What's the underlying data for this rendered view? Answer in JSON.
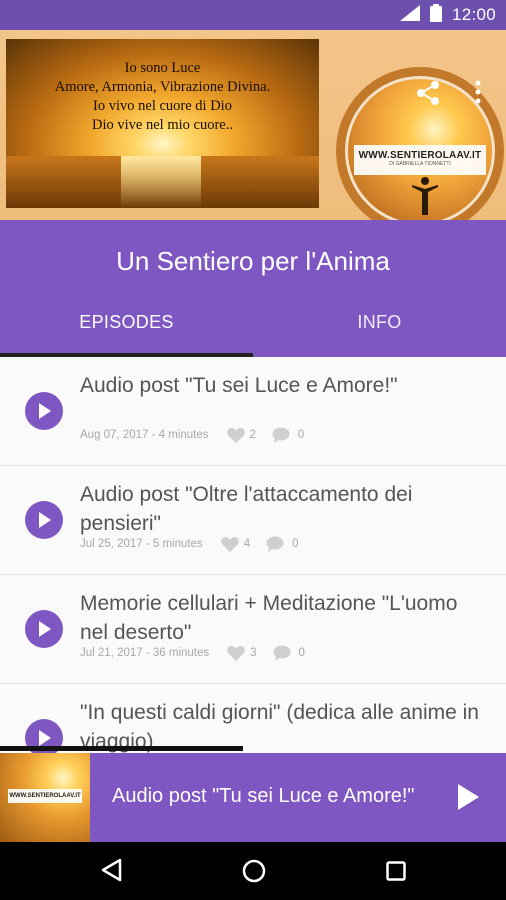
{
  "status_bar": {
    "time": "12:00"
  },
  "hero": {
    "quote_lines": [
      "Io sono Luce",
      "Amore, Armonia, Vibrazione Divina.",
      "Io vivo nel cuore di Dio",
      "Dio vive nel mio cuore.."
    ],
    "logo_url": "WWW.SENTIEROLAAV.IT",
    "logo_subtitle": "DI GABRIELLA TIONNETTI"
  },
  "header": {
    "title": "Un Sentiero per l'Anima",
    "tabs": [
      {
        "label": "EPISODES",
        "selected": true
      },
      {
        "label": "INFO",
        "selected": false
      }
    ]
  },
  "episodes": [
    {
      "title": "Audio post \"Tu sei Luce e Amore!\"",
      "meta": "Aug 07, 2017 - 4 minutes",
      "likes": "2",
      "comments": "0"
    },
    {
      "title": "Audio post \"Oltre l'attaccamento dei pensieri\"",
      "meta": "Jul 25, 2017 - 5 minutes",
      "likes": "4",
      "comments": "0"
    },
    {
      "title": "Memorie cellulari + Meditazione \"L'uomo nel deserto\"",
      "meta": "Jul 21, 2017 - 36 minutes",
      "likes": "3",
      "comments": "0"
    },
    {
      "title": "\"In questi caldi giorni\" (dedica alle anime in viaggio)",
      "meta": "",
      "likes": "",
      "comments": ""
    }
  ],
  "player": {
    "title": "Audio post \"Tu sei Luce e Amore!\"",
    "progress": 0.48,
    "thumb_label": "WWW.SENTIEROLAAV.IT"
  },
  "colors": {
    "primary": "#7e57c2",
    "status_bar": "#6d4fae",
    "indicator": "#212121"
  },
  "icons": [
    "share-icon",
    "more-vert-icon",
    "play-icon",
    "heart-icon",
    "comment-icon",
    "nav-back-icon",
    "nav-home-icon",
    "nav-recent-icon",
    "wifi-icon",
    "battery-icon"
  ]
}
